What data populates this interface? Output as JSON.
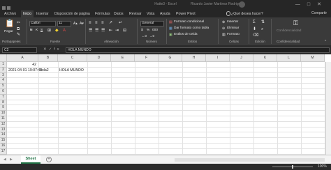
{
  "window": {
    "title": "Hatte3 - Excel",
    "user": "Ricardo Javier Martinez Rodriguez",
    "controls": [
      "—",
      "□",
      "✕"
    ]
  },
  "tabs": [
    "Archivo",
    "Inicio",
    "Insertar",
    "Disposición de página",
    "Fórmulas",
    "Datos",
    "Revisar",
    "Vista",
    "Ayuda",
    "Power Pivot",
    "¿Qué desea hacer?"
  ],
  "active_tab": "Inicio",
  "share_label": "Compartir",
  "ribbon": {
    "clipboard": {
      "paste": "Pegar",
      "label": "Portapapeles"
    },
    "font": {
      "name": "Calibri",
      "size": "11",
      "label": "Fuente",
      "bold": "N",
      "italic": "K",
      "underline": "S"
    },
    "alignment": {
      "label": "Alineación"
    },
    "number": {
      "format": "General",
      "label": "Número",
      "currency": "$",
      "percent": "%",
      "thousands": "000"
    },
    "styles": {
      "conditional": "Formato condicional",
      "table": "Dar formato como tabla",
      "cell_styles": "Estilos de celda",
      "label": "Estilos"
    },
    "cells": {
      "insert": "Insertar",
      "delete": "Eliminar",
      "format": "Formato",
      "label": "Celdas"
    },
    "editing": {
      "label": "Edición"
    },
    "sensitivity": {
      "button": "Confidencialidad",
      "label": "Confidencialidad"
    }
  },
  "formula_bar": {
    "name_box": "C2",
    "formula": "HOLA MUNDO",
    "fx": "fx"
  },
  "grid": {
    "columns": [
      "A",
      "B",
      "C",
      "D",
      "E",
      "F",
      "G",
      "H",
      "I",
      "J",
      "K",
      "L",
      "M"
    ],
    "rows": [
      "1",
      "2",
      "3",
      "4",
      "5",
      "6",
      "7",
      "8",
      "9",
      "10",
      "11",
      "12",
      "13",
      "14",
      "15",
      "16",
      "17"
    ],
    "cells": {
      "A1": "42",
      "A2": "2021-04-01 19:07:42",
      "B2": "hola2",
      "C2": "HOLA MUNDO"
    }
  },
  "sheets": [
    "Sheet"
  ],
  "status": {
    "zoom": "100%"
  }
}
